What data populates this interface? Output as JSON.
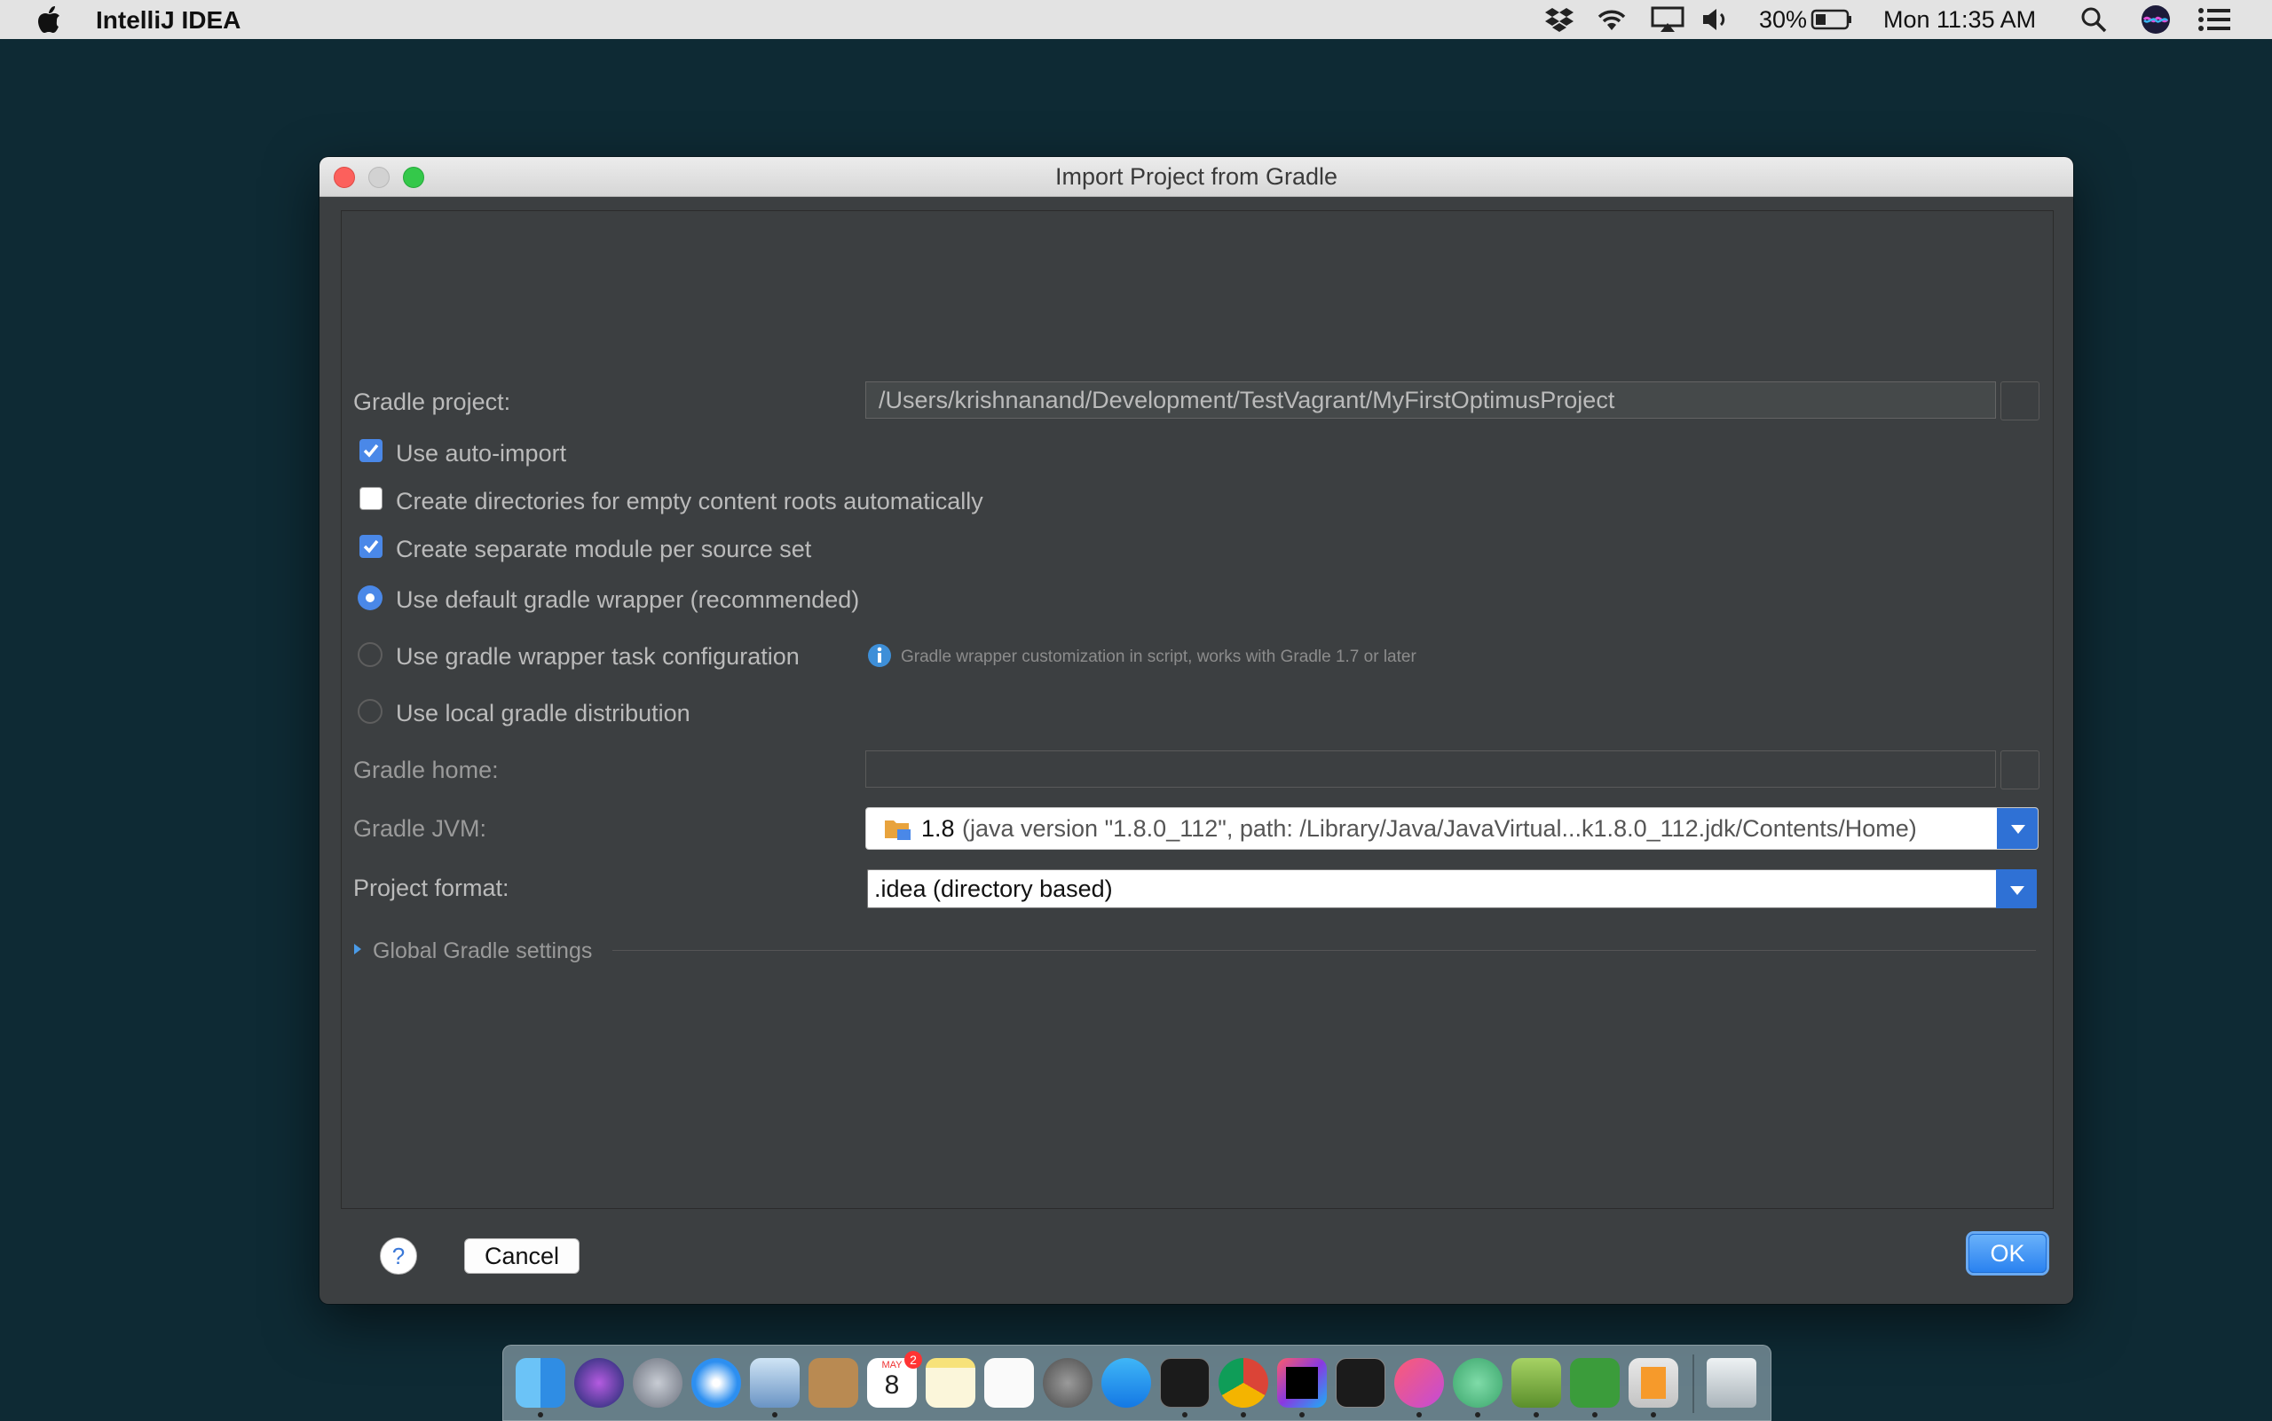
{
  "menubar": {
    "app_name": "IntelliJ IDEA",
    "battery": "30%",
    "clock": "Mon 11:35 AM",
    "icons": [
      "apple-icon",
      "dropbox-icon",
      "wifi-icon",
      "airplay-icon",
      "volume-icon",
      "battery-icon",
      "spotlight-icon",
      "siri-icon",
      "notification-center-icon"
    ]
  },
  "dialog": {
    "title": "Import Project from Gradle",
    "gradle_project_label": "Gradle project:",
    "gradle_project_value": "/Users/krishnanand/Development/TestVagrant/MyFirstOptimusProject",
    "use_auto_import": {
      "label": "Use auto-import",
      "checked": true
    },
    "create_dirs": {
      "label": "Create directories for empty content roots automatically",
      "checked": false
    },
    "separate_module": {
      "label": "Create separate module per source set",
      "checked": true
    },
    "radio_default_wrapper": {
      "label": "Use default gradle wrapper (recommended)",
      "selected": true
    },
    "radio_task_config": {
      "label": "Use gradle wrapper task configuration",
      "selected": false
    },
    "task_config_info": "Gradle wrapper customization in script, works with Gradle 1.7 or later",
    "radio_local_dist": {
      "label": "Use local gradle distribution",
      "selected": false
    },
    "gradle_home_label": "Gradle home:",
    "gradle_home_value": "",
    "gradle_jvm_label": "Gradle JVM:",
    "gradle_jvm_version": "1.8",
    "gradle_jvm_detail": "(java version \"1.8.0_112\", path: /Library/Java/JavaVirtual...k1.8.0_112.jdk/Contents/Home)",
    "project_format_label": "Project format:",
    "project_format_value": ".idea (directory based)",
    "global_settings_label": "Global Gradle settings",
    "help_label": "?",
    "cancel_label": "Cancel",
    "ok_label": "OK"
  },
  "dock": {
    "apps": [
      "finder-icon",
      "siri-icon",
      "launchpad-icon",
      "safari-icon",
      "mail-icon",
      "contacts-icon",
      "calendar-icon",
      "notes-icon",
      "reminders-icon",
      "system-preferences-icon",
      "app-store-icon",
      "terminal-icon",
      "chrome-icon",
      "intellij-icon",
      "activity-monitor-icon",
      "itunes-icon",
      "atom-icon",
      "android-studio-icon",
      "vim-icon",
      "sublime-icon",
      "trash-icon"
    ],
    "calendar_month": "MAY",
    "calendar_day": "8",
    "calendar_badge": "2"
  },
  "colors": {
    "accent": "#4a88e8",
    "dialog_bg": "#3c3f41",
    "desktop_bg": "#0e2a34"
  }
}
